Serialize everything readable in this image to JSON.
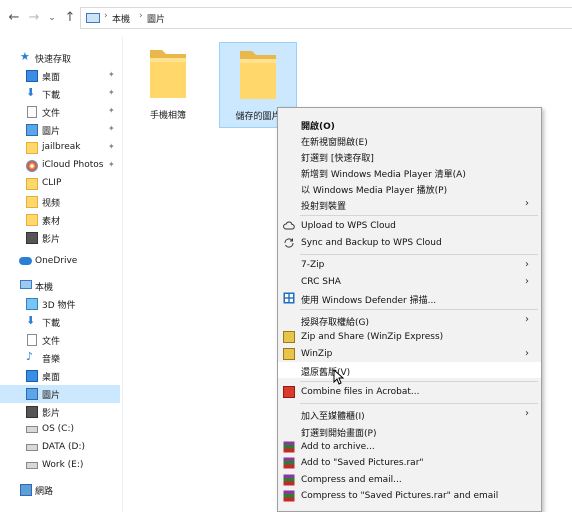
{
  "address": {
    "crumbs": [
      "本機",
      "圖片"
    ],
    "separator": "›"
  },
  "nav": {
    "quick_access": "快速存取",
    "quick_items": [
      {
        "label": "桌面",
        "icon": "desktop-icon"
      },
      {
        "label": "下載",
        "icon": "download-icon"
      },
      {
        "label": "文件",
        "icon": "document-icon"
      },
      {
        "label": "圖片",
        "icon": "pictures-icon"
      },
      {
        "label": "jailbreak",
        "icon": "folder-icon"
      },
      {
        "label": "iCloud Photos",
        "icon": "icloud-photos-icon"
      },
      {
        "label": "CLIP",
        "icon": "folder-icon"
      },
      {
        "label": "视频",
        "icon": "folder-icon"
      },
      {
        "label": "素材",
        "icon": "folder-icon"
      },
      {
        "label": "影片",
        "icon": "video-icon"
      }
    ],
    "onedrive": "OneDrive",
    "this_pc": "本機",
    "pc_items": [
      {
        "label": "3D 物件",
        "icon": "3d-objects-icon"
      },
      {
        "label": "下載",
        "icon": "download-icon"
      },
      {
        "label": "文件",
        "icon": "document-icon"
      },
      {
        "label": "音樂",
        "icon": "music-icon"
      },
      {
        "label": "桌面",
        "icon": "desktop-icon"
      },
      {
        "label": "圖片",
        "icon": "pictures-icon"
      },
      {
        "label": "影片",
        "icon": "video-icon"
      },
      {
        "label": "OS (C:)",
        "icon": "drive-icon"
      },
      {
        "label": "DATA (D:)",
        "icon": "drive-icon"
      },
      {
        "label": "Work (E:)",
        "icon": "drive-icon"
      }
    ],
    "network": "網路"
  },
  "folders": [
    {
      "label": "手機相簿"
    },
    {
      "label": "儲存的圖片"
    }
  ],
  "context_menu": {
    "items": [
      {
        "label": "開啟(O)",
        "bold": true
      },
      {
        "label": "在新視窗開啟(E)"
      },
      {
        "label": "釘選到 [快速存取]"
      },
      {
        "label": "新增到 Windows Media Player 清單(A)"
      },
      {
        "label": "以 Windows Media Player 播放(P)"
      },
      {
        "label": "投射到裝置",
        "submenu": true
      },
      {
        "label": "Upload to WPS Cloud",
        "icon": "cloud-icon"
      },
      {
        "label": "Sync and Backup to WPS Cloud",
        "icon": "sync-icon"
      },
      {
        "label": "7-Zip",
        "submenu": true
      },
      {
        "label": "CRC SHA",
        "submenu": true
      },
      {
        "label": "使用 Windows Defender 掃描...",
        "icon": "defender-icon"
      },
      {
        "label": "授與存取權給(G)",
        "submenu": true
      },
      {
        "label": "Zip and Share (WinZip Express)",
        "icon": "winzip-icon"
      },
      {
        "label": "WinZip",
        "icon": "winzip-icon",
        "submenu": true
      },
      {
        "label": "還原舊版(V)"
      },
      {
        "label": "Combine files in Acrobat...",
        "icon": "acrobat-icon"
      },
      {
        "label": "加入至媒體櫃(I)",
        "submenu": true
      },
      {
        "label": "釘選到開始畫面(P)"
      },
      {
        "label": "Add to archive...",
        "icon": "winrar-icon"
      },
      {
        "label": "Add to \"Saved Pictures.rar\"",
        "icon": "winrar-icon"
      },
      {
        "label": "Compress and email...",
        "icon": "winrar-icon"
      },
      {
        "label": "Compress to \"Saved Pictures.rar\" and email",
        "icon": "winrar-icon"
      }
    ]
  },
  "colors": {
    "selection": "#cce8ff",
    "folder": "#ffd76a",
    "accent": "#0078d7"
  }
}
